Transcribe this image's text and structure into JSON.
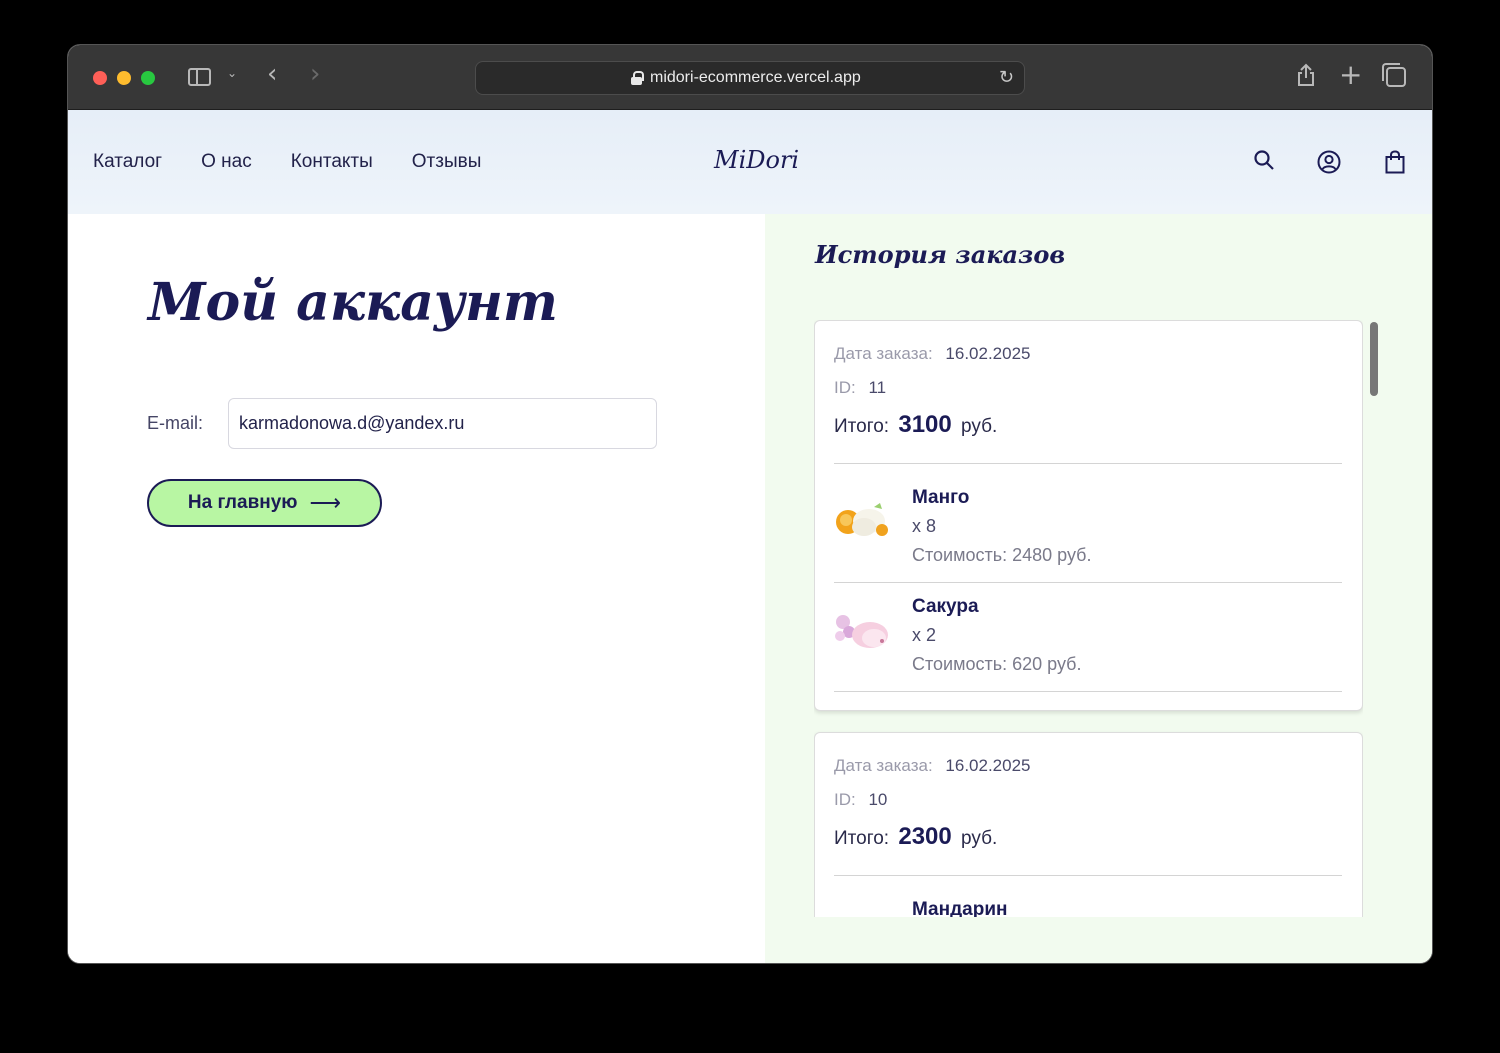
{
  "browser": {
    "url": "midori-ecommerce.vercel.app"
  },
  "header": {
    "nav": [
      "Каталог",
      "О нас",
      "Контакты",
      "Отзывы"
    ],
    "logo": "MiDori"
  },
  "account": {
    "title": "Мой аккаунт",
    "email_label": "E-mail:",
    "email_value": "karmadonowa.d@yandex.ru",
    "home_button": "На главную",
    "home_arrow": "⟶"
  },
  "orders": {
    "title": "История заказов",
    "date_label": "Дата заказа:",
    "id_label": "ID:",
    "total_label": "Итого:",
    "currency": "руб.",
    "cost_label": "Стоимость:",
    "list": [
      {
        "date": "16.02.2025",
        "id": "11",
        "total": "3100",
        "items": [
          {
            "name": "Манго",
            "qty": "x 8",
            "cost": "Стоимость: 2480 руб."
          },
          {
            "name": "Сакура",
            "qty": "x 2",
            "cost": "Стоимость: 620 руб."
          }
        ]
      },
      {
        "date": "16.02.2025",
        "id": "10",
        "total": "2300",
        "items": [
          {
            "name": "Мандарин"
          }
        ]
      }
    ]
  },
  "colors": {
    "accent": "#1b1b55",
    "button_bg": "#b8f6a3",
    "orders_bg": "#f2fbef",
    "header_bg": "#e6eef8"
  },
  "icons": [
    "sidebar-icon",
    "back-icon",
    "forward-icon",
    "lock-icon",
    "reload-icon",
    "share-icon",
    "plus-icon",
    "tabs-icon",
    "search-icon",
    "user-icon",
    "cart-icon",
    "arrow-right-icon"
  ]
}
